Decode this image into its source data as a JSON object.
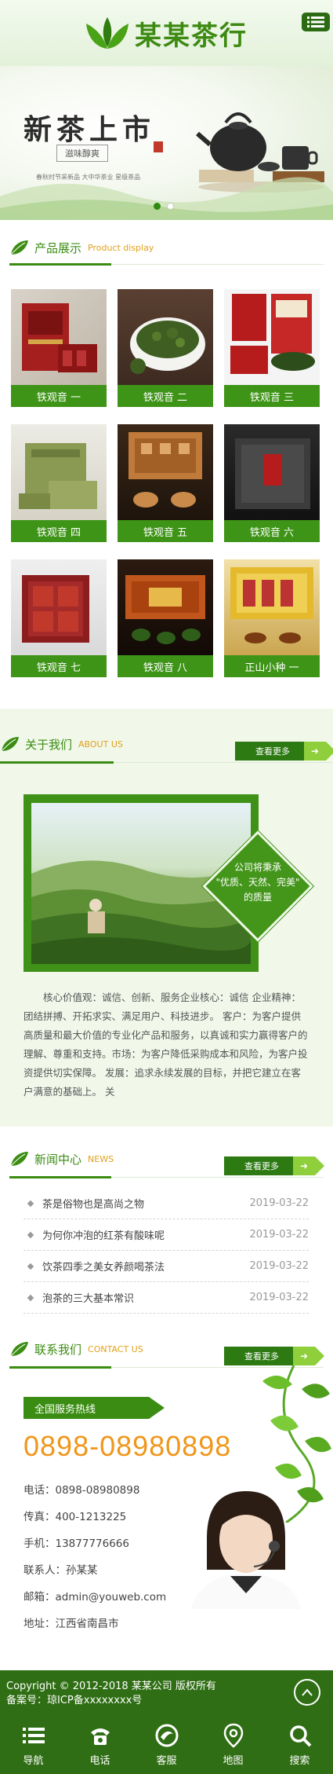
{
  "header": {
    "logo_text": "某某茶行"
  },
  "banner": {
    "title": "新茶上市",
    "subtitle": "滋味醇爽",
    "line": "春秋时节采新品 大中华茶业 星级茶品",
    "slides": 2,
    "active_slide": 1
  },
  "products": {
    "title": "产品展示",
    "title_en": "Product display",
    "items": [
      {
        "name": "铁观音 一",
        "image": "red-gift-box"
      },
      {
        "name": "铁观音 二",
        "image": "loose-leaf-tea"
      },
      {
        "name": "铁观音 三",
        "image": "red-tin"
      },
      {
        "name": "铁观音 四",
        "image": "green-box"
      },
      {
        "name": "铁观音 五",
        "image": "wooden-box"
      },
      {
        "name": "铁观音 六",
        "image": "black-box"
      },
      {
        "name": "铁观音 七",
        "image": "red-tea-bricks"
      },
      {
        "name": "铁观音 八",
        "image": "orange-gift-box"
      },
      {
        "name": "正山小种 一",
        "image": "yellow-gift-box"
      }
    ]
  },
  "about": {
    "title": "关于我们",
    "title_en": "ABOUT US",
    "more": "查看更多",
    "slogan_line1": "公司将秉承",
    "slogan_line2": "\"优质、天然、完美\"",
    "slogan_line3": "的质量",
    "text": "核心价值观：诚信、创新、服务企业核心：诚信 企业精神：团结拼搏、开拓求实、满足用户、科技进步。 客户：为客户提供高质量和最大价值的专业化产品和服务，以真诚和实力赢得客户的理解、尊重和支持。市场：为客户降低采购成本和风险，为客户投资提供切实保障。 发展：追求永续发展的目标，并把它建立在客户满意的基础上。 关"
  },
  "news": {
    "title": "新闻中心",
    "title_en": "NEWS",
    "more": "查看更多",
    "items": [
      {
        "title": "茶是俗物也是高尚之物",
        "date": "2019-03-22"
      },
      {
        "title": "为何你冲泡的红茶有酸味呢",
        "date": "2019-03-22"
      },
      {
        "title": "饮茶四季之美女养颜喝茶法",
        "date": "2019-03-22"
      },
      {
        "title": "泡茶的三大基本常识",
        "date": "2019-03-22"
      }
    ]
  },
  "contact": {
    "title": "联系我们",
    "title_en": "CONTACT US",
    "more": "查看更多",
    "hotline_label": "全国服务热线",
    "hotline": "0898-08980898",
    "phone": "电话：0898-08980898",
    "fax": "传真：400-1213225",
    "mobile": "手机：13877776666",
    "person": "联系人：孙某某",
    "email": "邮箱：admin@youweb.com",
    "address": "地址：江西省南昌市"
  },
  "footer": {
    "copyright": "Copyright © 2012-2018 某某公司 版权所有",
    "icp": "备案号：琼ICP备xxxxxxxx号"
  },
  "bottom_nav": [
    {
      "label": "导航",
      "icon": "menu-icon"
    },
    {
      "label": "电话",
      "icon": "phone-icon"
    },
    {
      "label": "客服",
      "icon": "chat-icon"
    },
    {
      "label": "地图",
      "icon": "map-pin-icon"
    },
    {
      "label": "搜索",
      "icon": "search-icon"
    }
  ],
  "colors": {
    "brand_green": "#3a8d12",
    "dark_green": "#2f6e14",
    "accent_orange": "#f0961a",
    "light_green_bg": "#f1f8ea"
  }
}
